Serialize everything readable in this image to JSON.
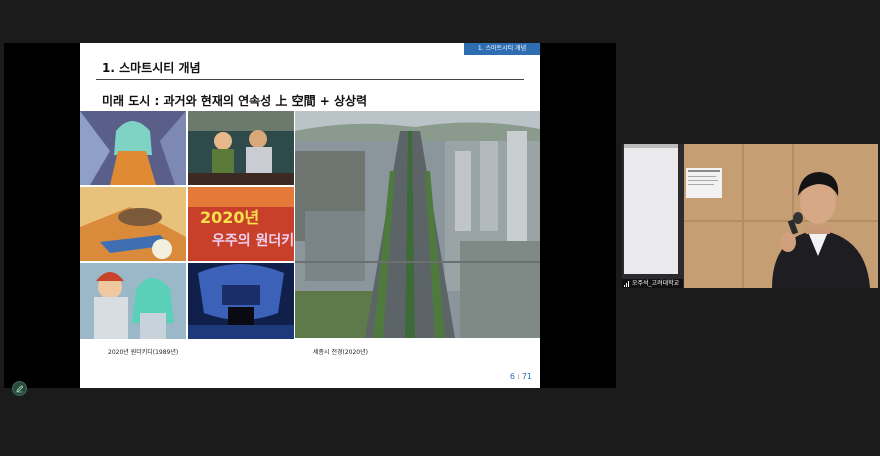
{
  "slide": {
    "section_tag": "1. 스마트시티 개념",
    "title": "1. 스마트시티 개념",
    "subtitle": "미래 도시 : 과거와 현재의 연속성 上 空間 + 상상력",
    "left_caption": "2020년 원더키디(1989년)",
    "right_caption": "세종시 전경(2020년)",
    "page_current": "6",
    "page_sep": "I",
    "page_total": "71"
  },
  "video": {
    "participant_name": "오주석_고려대학교",
    "signal_icon": "signal-bars-icon"
  },
  "toolbar": {
    "annotate_icon": "pen-icon"
  },
  "colors": {
    "accent": "#2f6db3",
    "background": "#1b1b1b",
    "annotate_button": "#2c4a3c"
  }
}
